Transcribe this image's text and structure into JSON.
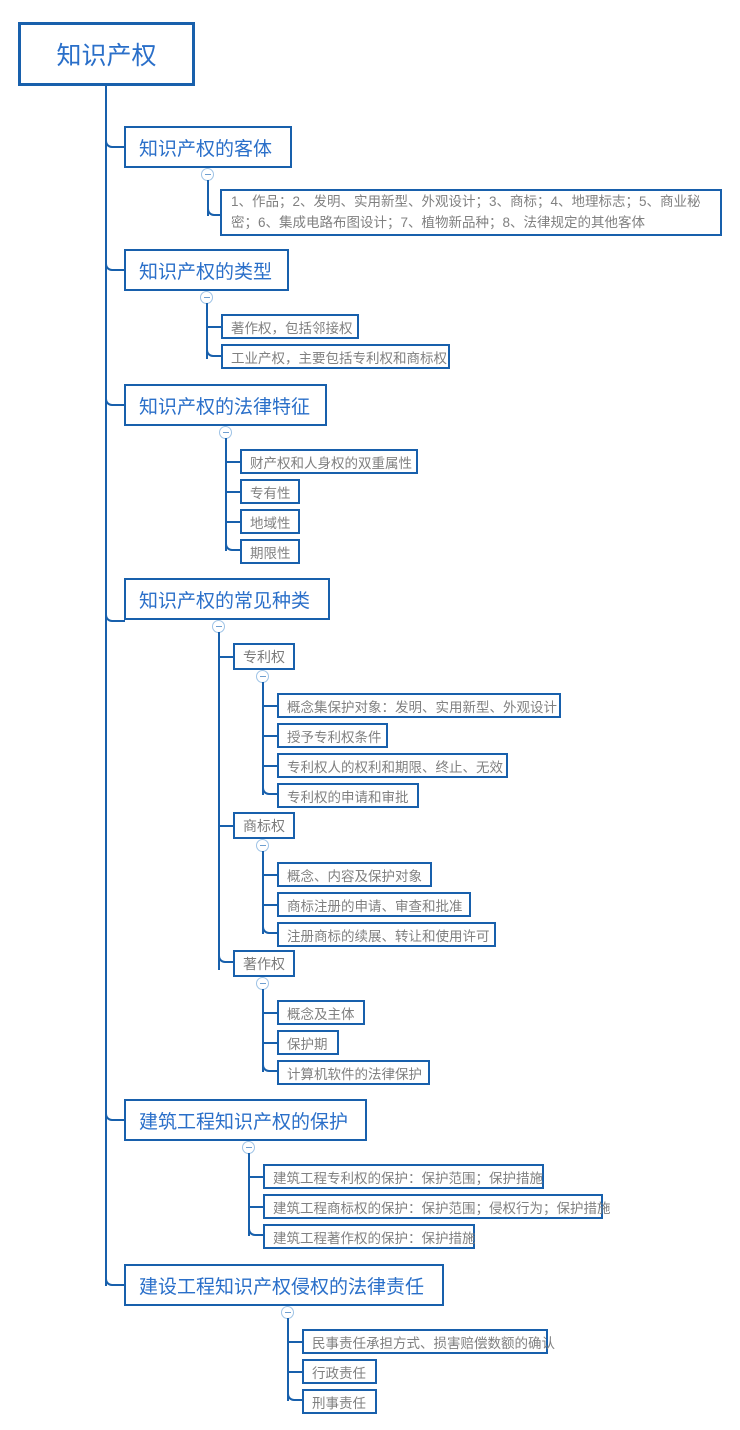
{
  "diagram": {
    "type": "mind-map",
    "root": {
      "label": "知识产权"
    },
    "branches": [
      {
        "label": "知识产权的客体",
        "children": [
          {
            "label": "1、作品；2、发明、实用新型、外观设计；3、商标；4、地理标志；5、商业秘密；6、集成电路布图设计；7、植物新品种；8、法律规定的其他客体"
          }
        ]
      },
      {
        "label": "知识产权的类型",
        "children": [
          {
            "label": "著作权，包括邻接权"
          },
          {
            "label": "工业产权，主要包括专利权和商标权"
          }
        ]
      },
      {
        "label": "知识产权的法律特征",
        "children": [
          {
            "label": "财产权和人身权的双重属性"
          },
          {
            "label": "专有性"
          },
          {
            "label": "地域性"
          },
          {
            "label": "期限性"
          }
        ]
      },
      {
        "label": "知识产权的常见种类",
        "groups": [
          {
            "label": "专利权",
            "children": [
              {
                "label": "概念集保护对象：发明、实用新型、外观设计"
              },
              {
                "label": "授予专利权条件"
              },
              {
                "label": "专利权人的权利和期限、终止、无效"
              },
              {
                "label": "专利权的申请和审批"
              }
            ]
          },
          {
            "label": "商标权",
            "children": [
              {
                "label": "概念、内容及保护对象"
              },
              {
                "label": "商标注册的申请、审查和批准"
              },
              {
                "label": "注册商标的续展、转让和使用许可"
              }
            ]
          },
          {
            "label": "著作权",
            "children": [
              {
                "label": "概念及主体"
              },
              {
                "label": "保护期"
              },
              {
                "label": "计算机软件的法律保护"
              }
            ]
          }
        ]
      },
      {
        "label": "建筑工程知识产权的保护",
        "children": [
          {
            "label": "建筑工程专利权的保护：保护范围；保护措施"
          },
          {
            "label": "建筑工程商标权的保护：保护范围；侵权行为；保护措施"
          },
          {
            "label": "建筑工程著作权的保护：保护措施"
          }
        ]
      },
      {
        "label": "建设工程知识产权侵权的法律责任",
        "children": [
          {
            "label": "民事责任承担方式、损害赔偿数额的确认"
          },
          {
            "label": "行政责任"
          },
          {
            "label": "刑事责任"
          }
        ]
      }
    ],
    "toggles": {
      "icon": "collapse-minus-icon",
      "count": 9
    },
    "colors": {
      "border": "#1860ac",
      "heading_text": "#2a6fc9",
      "leaf_text": "#808080",
      "toggle_border": "#9ec3e6",
      "background": "#ffffff"
    }
  }
}
